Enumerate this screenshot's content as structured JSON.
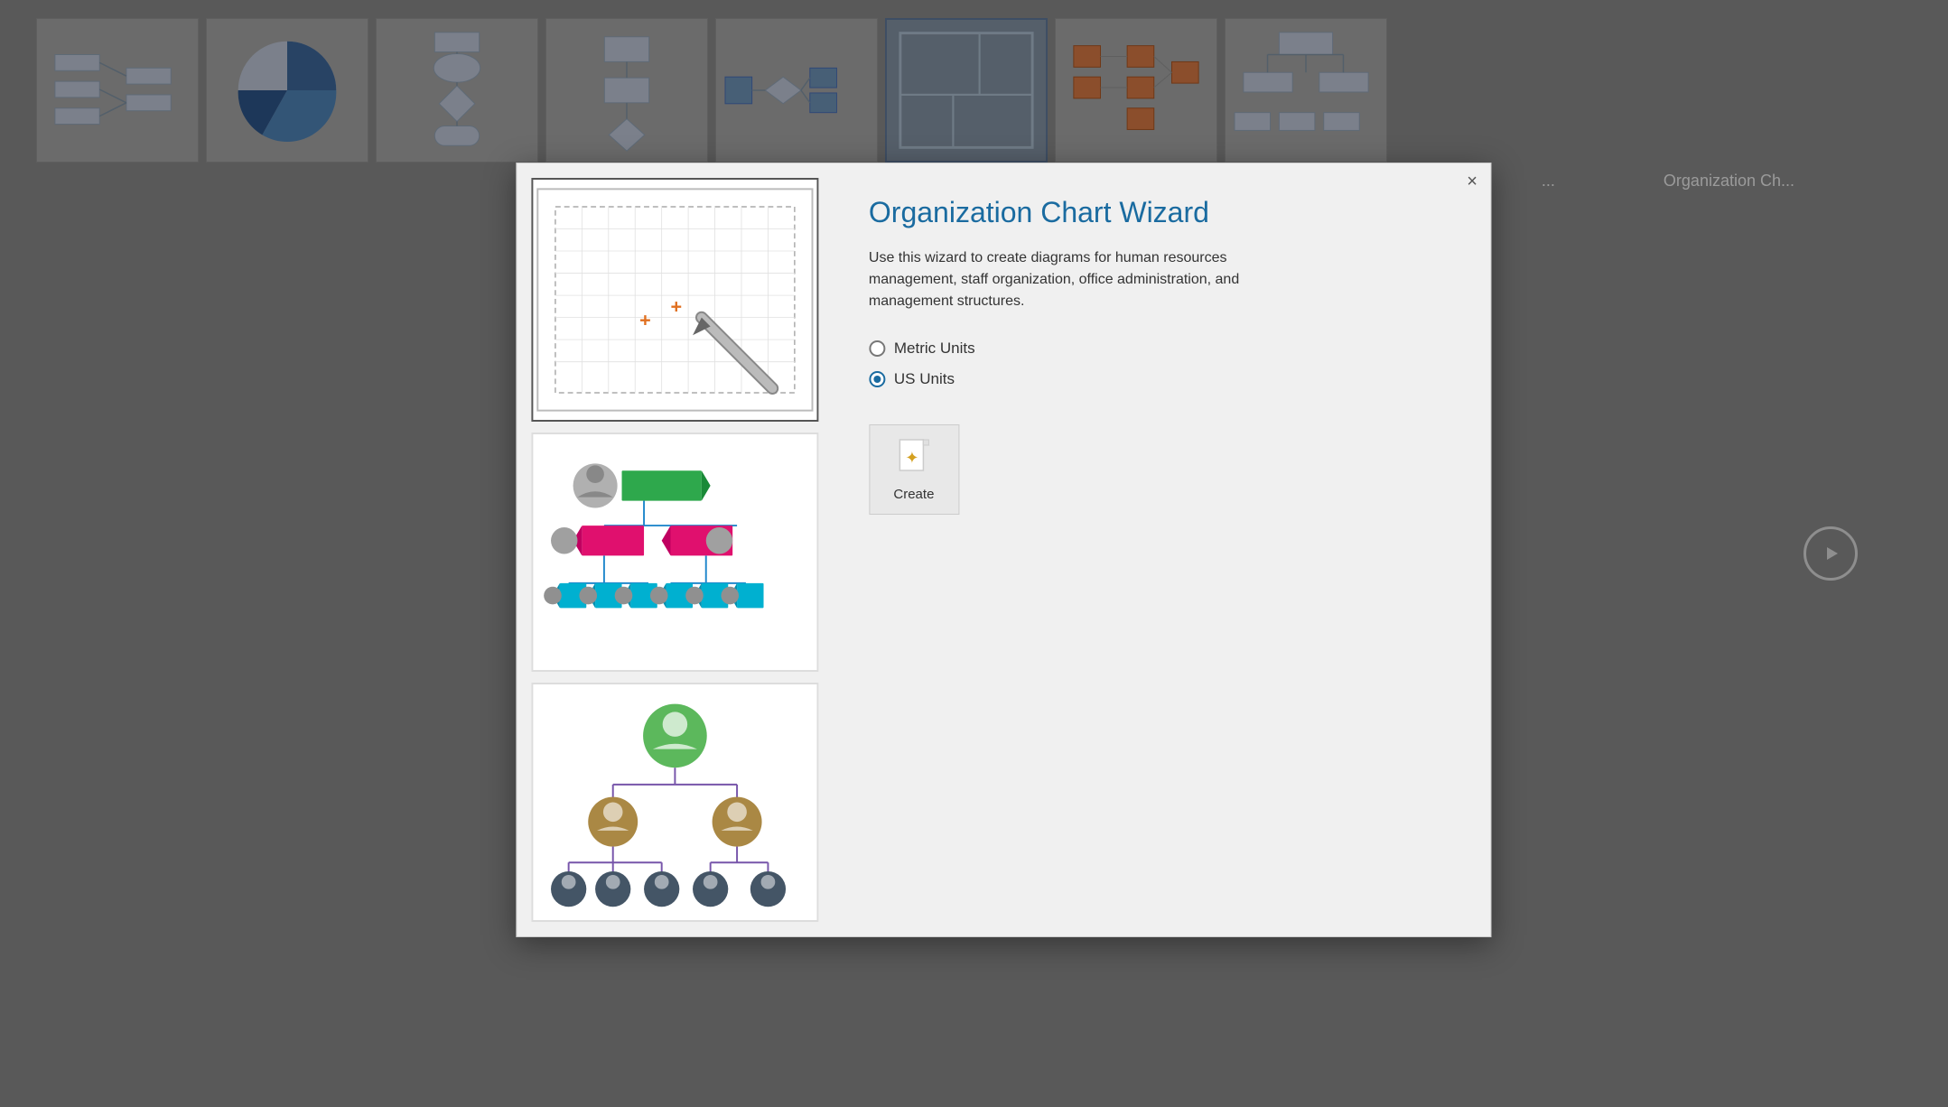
{
  "background": {
    "thumbnails": [
      {
        "name": "network-diagram",
        "label": ""
      },
      {
        "name": "pie-chart",
        "label": ""
      },
      {
        "name": "flowchart",
        "label": ""
      },
      {
        "name": "block-diagram",
        "label": ""
      },
      {
        "name": "data-flow",
        "label": ""
      },
      {
        "name": "floor-plan",
        "label": ""
      },
      {
        "name": "it-diagram",
        "label": "..."
      },
      {
        "name": "org-chart",
        "label": "Organization Ch..."
      }
    ]
  },
  "modal": {
    "title": "Organization Chart Wizard",
    "description": "Use this wizard to create diagrams for human resources management, staff organization, office administration, and management structures.",
    "close_label": "×",
    "units": {
      "metric_label": "Metric Units",
      "us_label": "US Units",
      "selected": "us"
    },
    "create_button_label": "Create",
    "thumbnails": [
      {
        "id": "blank",
        "label": "Blank canvas with grid"
      },
      {
        "id": "colorful",
        "label": "Colorful org chart"
      },
      {
        "id": "people",
        "label": "People org chart"
      }
    ]
  }
}
